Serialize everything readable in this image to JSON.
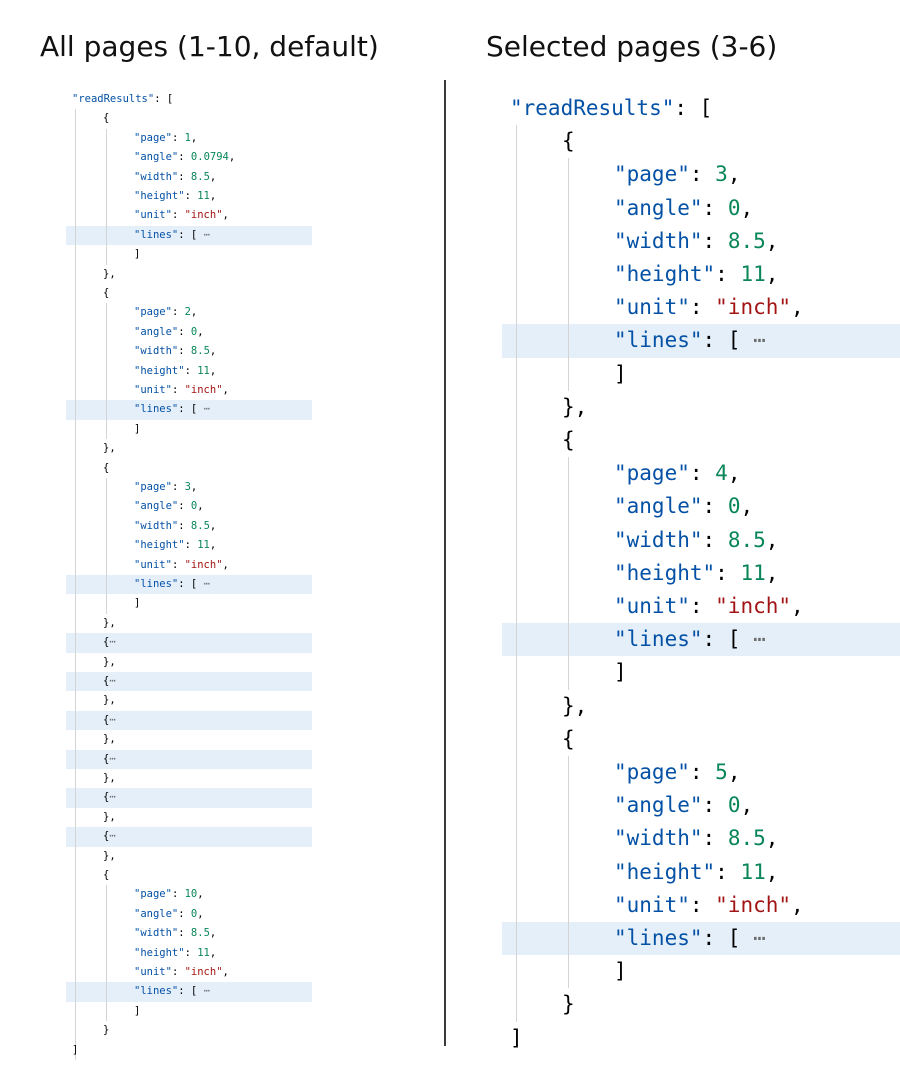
{
  "headings": {
    "left": "All pages (1-10, default)",
    "right": "Selected pages (3-6)"
  },
  "colors": {
    "key": "#0451a5",
    "number": "#098658",
    "string": "#a31515",
    "punct": "#000000",
    "highlight": "#e4effa"
  },
  "left": {
    "lines": [
      {
        "i": 0,
        "hl": false,
        "tok": [
          [
            "k",
            "\"readResults\""
          ],
          [
            "p",
            ": ["
          ]
        ]
      },
      {
        "i": 1,
        "hl": false,
        "tok": [
          [
            "p",
            "{"
          ]
        ]
      },
      {
        "i": 2,
        "hl": false,
        "tok": [
          [
            "k",
            "\"page\""
          ],
          [
            "p",
            ": "
          ],
          [
            "n",
            "1"
          ],
          [
            "p",
            ","
          ]
        ]
      },
      {
        "i": 2,
        "hl": false,
        "tok": [
          [
            "k",
            "\"angle\""
          ],
          [
            "p",
            ": "
          ],
          [
            "n",
            "0.0794"
          ],
          [
            "p",
            ","
          ]
        ]
      },
      {
        "i": 2,
        "hl": false,
        "tok": [
          [
            "k",
            "\"width\""
          ],
          [
            "p",
            ": "
          ],
          [
            "n",
            "8.5"
          ],
          [
            "p",
            ","
          ]
        ]
      },
      {
        "i": 2,
        "hl": false,
        "tok": [
          [
            "k",
            "\"height\""
          ],
          [
            "p",
            ": "
          ],
          [
            "n",
            "11"
          ],
          [
            "p",
            ","
          ]
        ]
      },
      {
        "i": 2,
        "hl": false,
        "tok": [
          [
            "k",
            "\"unit\""
          ],
          [
            "p",
            ": "
          ],
          [
            "s",
            "\"inch\""
          ],
          [
            "p",
            ","
          ]
        ]
      },
      {
        "i": 2,
        "hl": true,
        "tok": [
          [
            "k",
            "\"lines\""
          ],
          [
            "p",
            ": [ "
          ],
          [
            "e",
            "⋯"
          ]
        ]
      },
      {
        "i": 2,
        "hl": false,
        "tok": [
          [
            "p",
            "]"
          ]
        ]
      },
      {
        "i": 1,
        "hl": false,
        "tok": [
          [
            "p",
            "},"
          ]
        ]
      },
      {
        "i": 1,
        "hl": false,
        "tok": [
          [
            "p",
            "{"
          ]
        ]
      },
      {
        "i": 2,
        "hl": false,
        "tok": [
          [
            "k",
            "\"page\""
          ],
          [
            "p",
            ": "
          ],
          [
            "n",
            "2"
          ],
          [
            "p",
            ","
          ]
        ]
      },
      {
        "i": 2,
        "hl": false,
        "tok": [
          [
            "k",
            "\"angle\""
          ],
          [
            "p",
            ": "
          ],
          [
            "n",
            "0"
          ],
          [
            "p",
            ","
          ]
        ]
      },
      {
        "i": 2,
        "hl": false,
        "tok": [
          [
            "k",
            "\"width\""
          ],
          [
            "p",
            ": "
          ],
          [
            "n",
            "8.5"
          ],
          [
            "p",
            ","
          ]
        ]
      },
      {
        "i": 2,
        "hl": false,
        "tok": [
          [
            "k",
            "\"height\""
          ],
          [
            "p",
            ": "
          ],
          [
            "n",
            "11"
          ],
          [
            "p",
            ","
          ]
        ]
      },
      {
        "i": 2,
        "hl": false,
        "tok": [
          [
            "k",
            "\"unit\""
          ],
          [
            "p",
            ": "
          ],
          [
            "s",
            "\"inch\""
          ],
          [
            "p",
            ","
          ]
        ]
      },
      {
        "i": 2,
        "hl": true,
        "tok": [
          [
            "k",
            "\"lines\""
          ],
          [
            "p",
            ": [ "
          ],
          [
            "e",
            "⋯"
          ]
        ]
      },
      {
        "i": 2,
        "hl": false,
        "tok": [
          [
            "p",
            "]"
          ]
        ]
      },
      {
        "i": 1,
        "hl": false,
        "tok": [
          [
            "p",
            "},"
          ]
        ]
      },
      {
        "i": 1,
        "hl": false,
        "tok": [
          [
            "p",
            "{"
          ]
        ]
      },
      {
        "i": 2,
        "hl": false,
        "tok": [
          [
            "k",
            "\"page\""
          ],
          [
            "p",
            ": "
          ],
          [
            "n",
            "3"
          ],
          [
            "p",
            ","
          ]
        ]
      },
      {
        "i": 2,
        "hl": false,
        "tok": [
          [
            "k",
            "\"angle\""
          ],
          [
            "p",
            ": "
          ],
          [
            "n",
            "0"
          ],
          [
            "p",
            ","
          ]
        ]
      },
      {
        "i": 2,
        "hl": false,
        "tok": [
          [
            "k",
            "\"width\""
          ],
          [
            "p",
            ": "
          ],
          [
            "n",
            "8.5"
          ],
          [
            "p",
            ","
          ]
        ]
      },
      {
        "i": 2,
        "hl": false,
        "tok": [
          [
            "k",
            "\"height\""
          ],
          [
            "p",
            ": "
          ],
          [
            "n",
            "11"
          ],
          [
            "p",
            ","
          ]
        ]
      },
      {
        "i": 2,
        "hl": false,
        "tok": [
          [
            "k",
            "\"unit\""
          ],
          [
            "p",
            ": "
          ],
          [
            "s",
            "\"inch\""
          ],
          [
            "p",
            ","
          ]
        ]
      },
      {
        "i": 2,
        "hl": true,
        "tok": [
          [
            "k",
            "\"lines\""
          ],
          [
            "p",
            ": [ "
          ],
          [
            "e",
            "⋯"
          ]
        ]
      },
      {
        "i": 2,
        "hl": false,
        "tok": [
          [
            "p",
            "]"
          ]
        ]
      },
      {
        "i": 1,
        "hl": false,
        "tok": [
          [
            "p",
            "},"
          ]
        ]
      },
      {
        "i": 1,
        "hl": true,
        "tok": [
          [
            "p",
            "{"
          ],
          [
            "e",
            "⋯"
          ]
        ]
      },
      {
        "i": 1,
        "hl": false,
        "tok": [
          [
            "p",
            "},"
          ]
        ]
      },
      {
        "i": 1,
        "hl": true,
        "tok": [
          [
            "p",
            "{"
          ],
          [
            "e",
            "⋯"
          ]
        ]
      },
      {
        "i": 1,
        "hl": false,
        "tok": [
          [
            "p",
            "},"
          ]
        ]
      },
      {
        "i": 1,
        "hl": true,
        "tok": [
          [
            "p",
            "{"
          ],
          [
            "e",
            "⋯"
          ]
        ]
      },
      {
        "i": 1,
        "hl": false,
        "tok": [
          [
            "p",
            "},"
          ]
        ]
      },
      {
        "i": 1,
        "hl": true,
        "tok": [
          [
            "p",
            "{"
          ],
          [
            "e",
            "⋯"
          ]
        ]
      },
      {
        "i": 1,
        "hl": false,
        "tok": [
          [
            "p",
            "},"
          ]
        ]
      },
      {
        "i": 1,
        "hl": true,
        "tok": [
          [
            "p",
            "{"
          ],
          [
            "e",
            "⋯"
          ]
        ]
      },
      {
        "i": 1,
        "hl": false,
        "tok": [
          [
            "p",
            "},"
          ]
        ]
      },
      {
        "i": 1,
        "hl": true,
        "tok": [
          [
            "p",
            "{"
          ],
          [
            "e",
            "⋯"
          ]
        ]
      },
      {
        "i": 1,
        "hl": false,
        "tok": [
          [
            "p",
            "},"
          ]
        ]
      },
      {
        "i": 1,
        "hl": false,
        "tok": [
          [
            "p",
            "{"
          ]
        ]
      },
      {
        "i": 2,
        "hl": false,
        "tok": [
          [
            "k",
            "\"page\""
          ],
          [
            "p",
            ": "
          ],
          [
            "n",
            "10"
          ],
          [
            "p",
            ","
          ]
        ]
      },
      {
        "i": 2,
        "hl": false,
        "tok": [
          [
            "k",
            "\"angle\""
          ],
          [
            "p",
            ": "
          ],
          [
            "n",
            "0"
          ],
          [
            "p",
            ","
          ]
        ]
      },
      {
        "i": 2,
        "hl": false,
        "tok": [
          [
            "k",
            "\"width\""
          ],
          [
            "p",
            ": "
          ],
          [
            "n",
            "8.5"
          ],
          [
            "p",
            ","
          ]
        ]
      },
      {
        "i": 2,
        "hl": false,
        "tok": [
          [
            "k",
            "\"height\""
          ],
          [
            "p",
            ": "
          ],
          [
            "n",
            "11"
          ],
          [
            "p",
            ","
          ]
        ]
      },
      {
        "i": 2,
        "hl": false,
        "tok": [
          [
            "k",
            "\"unit\""
          ],
          [
            "p",
            ": "
          ],
          [
            "s",
            "\"inch\""
          ],
          [
            "p",
            ","
          ]
        ]
      },
      {
        "i": 2,
        "hl": true,
        "tok": [
          [
            "k",
            "\"lines\""
          ],
          [
            "p",
            ": [ "
          ],
          [
            "e",
            "⋯"
          ]
        ]
      },
      {
        "i": 2,
        "hl": false,
        "tok": [
          [
            "p",
            "]"
          ]
        ]
      },
      {
        "i": 1,
        "hl": false,
        "tok": [
          [
            "p",
            "}"
          ]
        ]
      },
      {
        "i": 0,
        "hl": false,
        "tok": [
          [
            "p",
            "]"
          ]
        ]
      }
    ]
  },
  "right": {
    "lines": [
      {
        "i": 0,
        "hl": false,
        "tok": [
          [
            "k",
            "\"readResults\""
          ],
          [
            "p",
            ": ["
          ]
        ]
      },
      {
        "i": 1,
        "hl": false,
        "tok": [
          [
            "p",
            "{"
          ]
        ]
      },
      {
        "i": 2,
        "hl": false,
        "tok": [
          [
            "k",
            "\"page\""
          ],
          [
            "p",
            ": "
          ],
          [
            "n",
            "3"
          ],
          [
            "p",
            ","
          ]
        ]
      },
      {
        "i": 2,
        "hl": false,
        "tok": [
          [
            "k",
            "\"angle\""
          ],
          [
            "p",
            ": "
          ],
          [
            "n",
            "0"
          ],
          [
            "p",
            ","
          ]
        ]
      },
      {
        "i": 2,
        "hl": false,
        "tok": [
          [
            "k",
            "\"width\""
          ],
          [
            "p",
            ": "
          ],
          [
            "n",
            "8.5"
          ],
          [
            "p",
            ","
          ]
        ]
      },
      {
        "i": 2,
        "hl": false,
        "tok": [
          [
            "k",
            "\"height\""
          ],
          [
            "p",
            ": "
          ],
          [
            "n",
            "11"
          ],
          [
            "p",
            ","
          ]
        ]
      },
      {
        "i": 2,
        "hl": false,
        "tok": [
          [
            "k",
            "\"unit\""
          ],
          [
            "p",
            ": "
          ],
          [
            "s",
            "\"inch\""
          ],
          [
            "p",
            ","
          ]
        ]
      },
      {
        "i": 2,
        "hl": true,
        "tok": [
          [
            "k",
            "\"lines\""
          ],
          [
            "p",
            ": [ "
          ],
          [
            "e",
            "⋯"
          ]
        ]
      },
      {
        "i": 2,
        "hl": false,
        "tok": [
          [
            "p",
            "]"
          ]
        ]
      },
      {
        "i": 1,
        "hl": false,
        "tok": [
          [
            "p",
            "},"
          ]
        ]
      },
      {
        "i": 1,
        "hl": false,
        "tok": [
          [
            "p",
            "{"
          ]
        ]
      },
      {
        "i": 2,
        "hl": false,
        "tok": [
          [
            "k",
            "\"page\""
          ],
          [
            "p",
            ": "
          ],
          [
            "n",
            "4"
          ],
          [
            "p",
            ","
          ]
        ]
      },
      {
        "i": 2,
        "hl": false,
        "tok": [
          [
            "k",
            "\"angle\""
          ],
          [
            "p",
            ": "
          ],
          [
            "n",
            "0"
          ],
          [
            "p",
            ","
          ]
        ]
      },
      {
        "i": 2,
        "hl": false,
        "tok": [
          [
            "k",
            "\"width\""
          ],
          [
            "p",
            ": "
          ],
          [
            "n",
            "8.5"
          ],
          [
            "p",
            ","
          ]
        ]
      },
      {
        "i": 2,
        "hl": false,
        "tok": [
          [
            "k",
            "\"height\""
          ],
          [
            "p",
            ": "
          ],
          [
            "n",
            "11"
          ],
          [
            "p",
            ","
          ]
        ]
      },
      {
        "i": 2,
        "hl": false,
        "tok": [
          [
            "k",
            "\"unit\""
          ],
          [
            "p",
            ": "
          ],
          [
            "s",
            "\"inch\""
          ],
          [
            "p",
            ","
          ]
        ]
      },
      {
        "i": 2,
        "hl": true,
        "tok": [
          [
            "k",
            "\"lines\""
          ],
          [
            "p",
            ": [ "
          ],
          [
            "e",
            "⋯"
          ]
        ]
      },
      {
        "i": 2,
        "hl": false,
        "tok": [
          [
            "p",
            "]"
          ]
        ]
      },
      {
        "i": 1,
        "hl": false,
        "tok": [
          [
            "p",
            "},"
          ]
        ]
      },
      {
        "i": 1,
        "hl": false,
        "tok": [
          [
            "p",
            "{"
          ]
        ]
      },
      {
        "i": 2,
        "hl": false,
        "tok": [
          [
            "k",
            "\"page\""
          ],
          [
            "p",
            ": "
          ],
          [
            "n",
            "5"
          ],
          [
            "p",
            ","
          ]
        ]
      },
      {
        "i": 2,
        "hl": false,
        "tok": [
          [
            "k",
            "\"angle\""
          ],
          [
            "p",
            ": "
          ],
          [
            "n",
            "0"
          ],
          [
            "p",
            ","
          ]
        ]
      },
      {
        "i": 2,
        "hl": false,
        "tok": [
          [
            "k",
            "\"width\""
          ],
          [
            "p",
            ": "
          ],
          [
            "n",
            "8.5"
          ],
          [
            "p",
            ","
          ]
        ]
      },
      {
        "i": 2,
        "hl": false,
        "tok": [
          [
            "k",
            "\"height\""
          ],
          [
            "p",
            ": "
          ],
          [
            "n",
            "11"
          ],
          [
            "p",
            ","
          ]
        ]
      },
      {
        "i": 2,
        "hl": false,
        "tok": [
          [
            "k",
            "\"unit\""
          ],
          [
            "p",
            ": "
          ],
          [
            "s",
            "\"inch\""
          ],
          [
            "p",
            ","
          ]
        ]
      },
      {
        "i": 2,
        "hl": true,
        "tok": [
          [
            "k",
            "\"lines\""
          ],
          [
            "p",
            ": [ "
          ],
          [
            "e",
            "⋯"
          ]
        ]
      },
      {
        "i": 2,
        "hl": false,
        "tok": [
          [
            "p",
            "]"
          ]
        ]
      },
      {
        "i": 1,
        "hl": false,
        "tok": [
          [
            "p",
            "}"
          ]
        ]
      },
      {
        "i": 0,
        "hl": false,
        "tok": [
          [
            "p",
            "]"
          ]
        ]
      }
    ]
  }
}
